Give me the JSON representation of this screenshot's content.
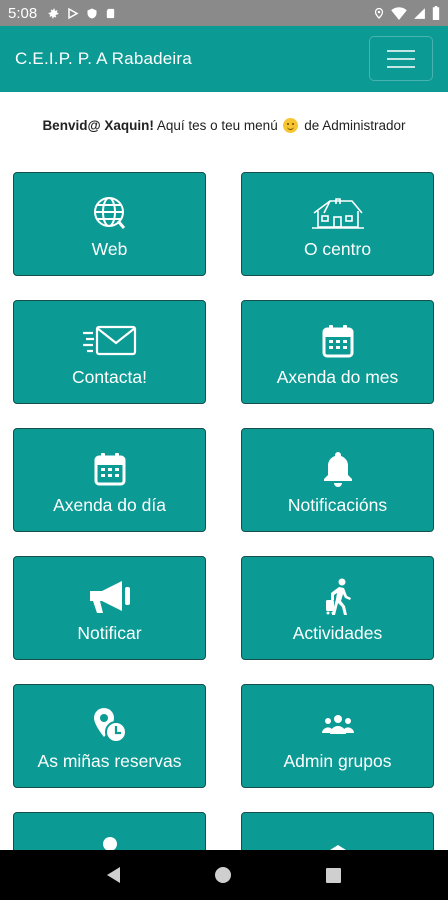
{
  "status_bar": {
    "time": "5:08",
    "left_icons": [
      "settings-icon",
      "play-store-icon",
      "shield-icon",
      "sd-card-icon"
    ],
    "right_icons": [
      "location-icon",
      "wifi-icon",
      "signal-icon",
      "battery-icon"
    ]
  },
  "app_bar": {
    "title": "C.E.I.P. P. A Rabadeira",
    "menu_icon": "hamburger-menu-icon"
  },
  "welcome": {
    "greeting": "Benvid@ Xaquin!",
    "text_before_emoji": "Aquí tes o teu menú",
    "emoji": "smiling-face-emoji",
    "text_after_emoji": "de Administrador"
  },
  "tiles": [
    {
      "label": "Web",
      "icon": "globe-icon"
    },
    {
      "label": "O centro",
      "icon": "school-building-icon"
    },
    {
      "label": "Contacta!",
      "icon": "envelope-icon"
    },
    {
      "label": "Axenda do mes",
      "icon": "calendar-icon"
    },
    {
      "label": "Axenda do día",
      "icon": "calendar-icon"
    },
    {
      "label": "Notificacións",
      "icon": "bell-icon"
    },
    {
      "label": "Notificar",
      "icon": "megaphone-icon"
    },
    {
      "label": "Actividades",
      "icon": "traveler-icon"
    },
    {
      "label": "As miñas reservas",
      "icon": "location-clock-icon"
    },
    {
      "label": "Admin grupos",
      "icon": "users-group-icon"
    },
    {
      "label": "",
      "icon": "user-icon"
    },
    {
      "label": "",
      "icon": "home-icon"
    }
  ],
  "colors": {
    "primary": "#0b9a94",
    "tile_border": "#15504c",
    "status_bar": "#8a8a8a",
    "nav_bar": "#000000",
    "text_on_primary": "#ffffff"
  },
  "nav_bar": {
    "icons": [
      "back-icon",
      "home-circle-icon",
      "recent-apps-icon"
    ]
  }
}
